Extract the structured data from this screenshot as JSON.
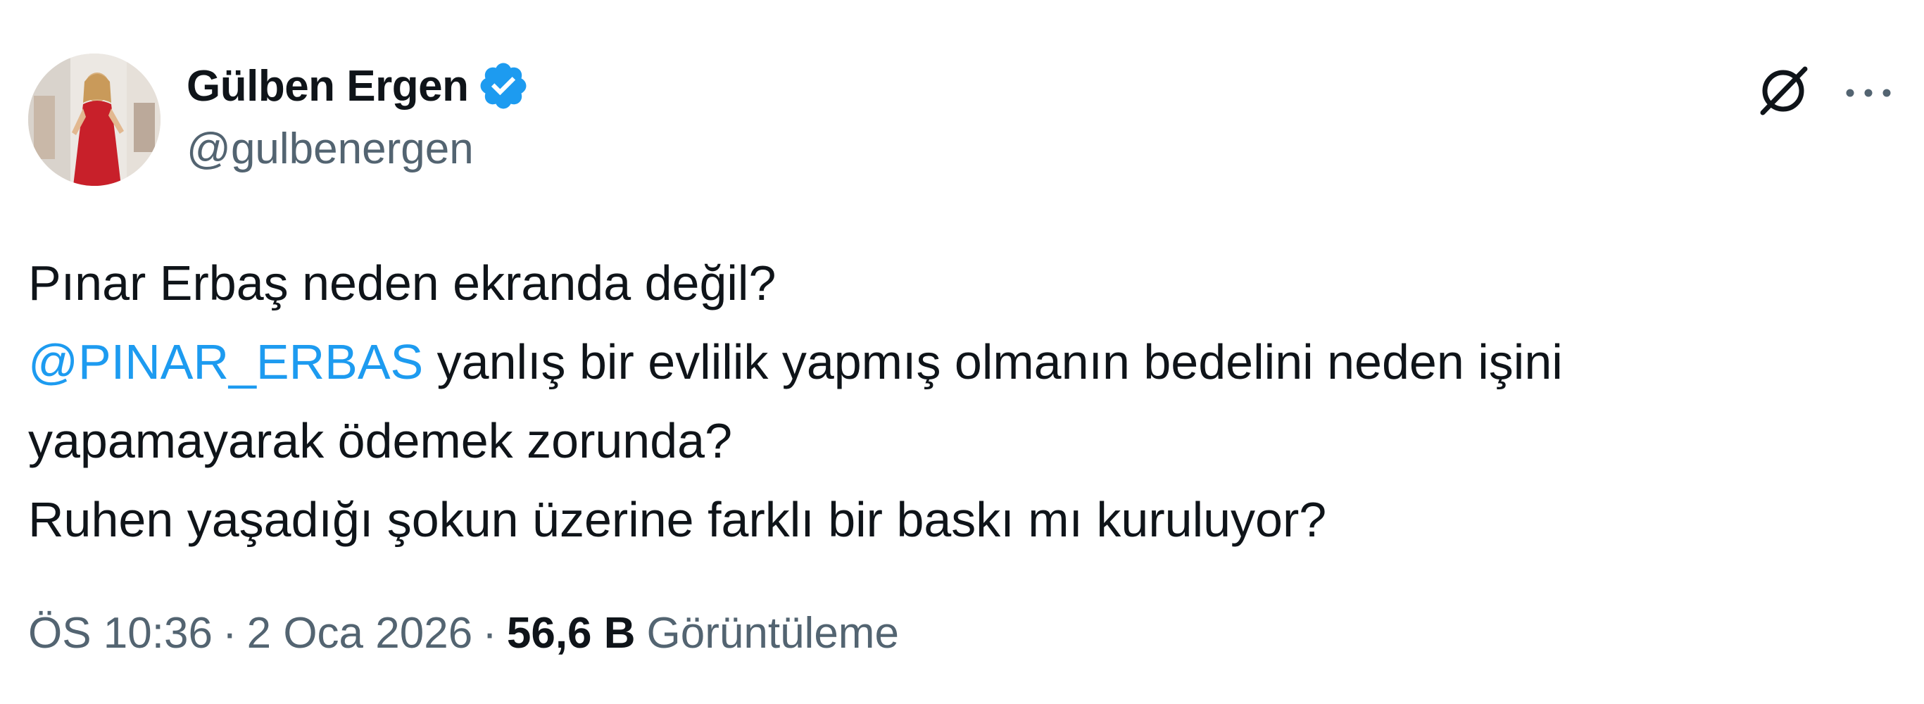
{
  "author": {
    "display_name": "Gülben Ergen",
    "handle": "@gulbenergen",
    "verified": true,
    "avatar_icon": "profile-photo"
  },
  "actions": {
    "grok_icon": "grok-icon",
    "more_icon": "more-options-icon"
  },
  "tweet": {
    "line1": "Pınar Erbaş neden ekranda değil?",
    "mention": "@PINAR_ERBAS",
    "line2_rest": " yanlış bir evlilik yapmış olmanın bedelini neden işini",
    "line3": "yapamayarak ödemek zorunda?",
    "line4": "Ruhen yaşadığı şokun üzerine farklı bir baskı mı kuruluyor?"
  },
  "meta": {
    "time": "ÖS 10:36",
    "separator": "·",
    "date": "2 Oca 2026",
    "views_count": "56,6 B",
    "views_label": "Görüntüleme"
  },
  "colors": {
    "text": "#0f1419",
    "secondary": "#536471",
    "link": "#1d9bf0",
    "verified_badge": "#1d9bf0"
  }
}
